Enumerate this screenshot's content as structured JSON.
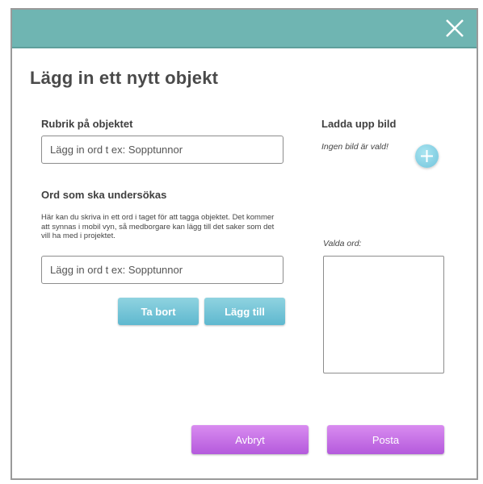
{
  "dialog": {
    "title": "Lägg in ett nytt objekt",
    "close_icon": "close-icon",
    "colors": {
      "titlebar": "#6fb5b2",
      "teal_button": "#6cc0d5",
      "purple_button": "#c46ee6"
    }
  },
  "form": {
    "title_label": "Rubrik på objektet",
    "title_placeholder": "Lägg in ord t ex: Sopptunnor",
    "words_label": "Ord som ska undersökas",
    "words_help": "Här kan du skriva in ett ord i taget för att tagga objektet. Det kommer att synnas i mobil vyn, så medborgare kan lägg till det saker som det vill ha med i projektet.",
    "word_placeholder": "Lägg in ord t ex: Sopptunnor",
    "remove_label": "Ta bort",
    "add_label": "Lägg till"
  },
  "upload": {
    "label": "Ladda upp bild",
    "status": "Ingen bild är vald!",
    "add_icon": "plus-icon"
  },
  "selected_words": {
    "label": "Valda ord:",
    "items": []
  },
  "footer": {
    "cancel_label": "Avbryt",
    "post_label": "Posta"
  }
}
